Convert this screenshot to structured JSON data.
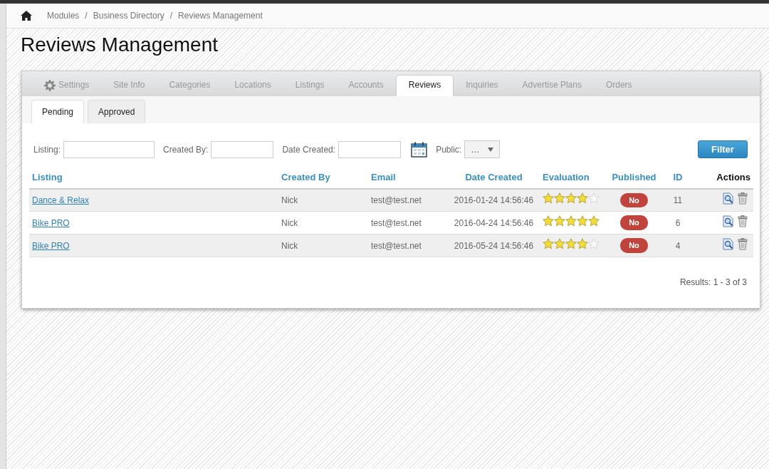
{
  "breadcrumb": [
    {
      "label": "Modules",
      "separator": "/"
    },
    {
      "label": "Business Directory",
      "separator": "/"
    },
    {
      "label": "Reviews Management"
    }
  ],
  "title": "Reviews Management",
  "tabs": [
    {
      "label": "Settings",
      "kind": "icon",
      "selected": false
    },
    {
      "label": "Site Info",
      "kind": "plain",
      "selected": false
    },
    {
      "label": "Categories",
      "kind": "plain",
      "selected": false
    },
    {
      "label": "Locations",
      "kind": "plain",
      "selected": false
    },
    {
      "label": "Listings",
      "kind": "plain",
      "selected": false
    },
    {
      "label": "Accounts",
      "kind": "plain",
      "selected": false
    },
    {
      "label": "Reviews",
      "kind": "plain",
      "selected": true
    },
    {
      "label": "Inquiries",
      "kind": "plain",
      "selected": false
    },
    {
      "label": "Advertise Plans",
      "kind": "plain",
      "selected": false
    },
    {
      "label": "Orders",
      "kind": "plain",
      "selected": false
    }
  ],
  "subtabs": [
    {
      "label": "Pending",
      "selected": true
    },
    {
      "label": "Approved",
      "selected": false
    }
  ],
  "filters": {
    "listing_label": "Listing:",
    "created_by_label": "Created By:",
    "date_created_label": "Date Created:",
    "public_label": "Public:",
    "public_value": "…",
    "button": "Filter"
  },
  "table": {
    "columns": [
      {
        "label": "Listing",
        "sortable": true
      },
      {
        "label": "Created By",
        "sortable": true
      },
      {
        "label": "Email",
        "sortable": true
      },
      {
        "label": "Date Created",
        "sortable": true
      },
      {
        "label": "Evaluation",
        "sortable": true
      },
      {
        "label": "Published",
        "sortable": true
      },
      {
        "label": "ID",
        "sortable": true
      },
      {
        "label": "Actions",
        "sortable": false
      }
    ],
    "rows": [
      {
        "listing": "Dance & Relax",
        "created_by": "Nick",
        "email": "test@test.net",
        "date_created": "2016-01-24 14:56:46",
        "stars": 4,
        "published": "No",
        "id": "11"
      },
      {
        "listing": "Bike PRO",
        "created_by": "Nick",
        "email": "test@test.net",
        "date_created": "2016-04-24 14:56:46",
        "stars": 5,
        "published": "No",
        "id": "6"
      },
      {
        "listing": "Bike PRO",
        "created_by": "Nick",
        "email": "test@test.net",
        "date_created": "2016-05-24 14:56:46",
        "stars": 4,
        "published": "No",
        "id": "4"
      }
    ]
  },
  "results": "Results: 1 - 3 of 3"
}
